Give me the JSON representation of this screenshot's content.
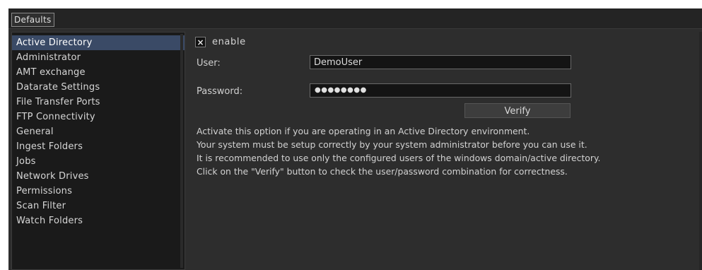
{
  "tabs": [
    {
      "label": "Defaults",
      "active": true
    }
  ],
  "sidebar": {
    "selected_index": 0,
    "items": [
      {
        "label": "Active Directory"
      },
      {
        "label": "Administrator"
      },
      {
        "label": "AMT exchange"
      },
      {
        "label": "Datarate Settings"
      },
      {
        "label": "File Transfer Ports"
      },
      {
        "label": "FTP Connectivity"
      },
      {
        "label": "General"
      },
      {
        "label": "Ingest Folders"
      },
      {
        "label": "Jobs"
      },
      {
        "label": "Network Drives"
      },
      {
        "label": "Permissions"
      },
      {
        "label": "Scan Filter"
      },
      {
        "label": "Watch Folders"
      }
    ]
  },
  "form": {
    "enable": {
      "checked": true,
      "mark": "×",
      "label": "enable"
    },
    "user": {
      "label": "User:",
      "value": "DemoUser"
    },
    "password": {
      "label": "Password:",
      "masked": "●●●●●●●●"
    },
    "verify_label": "Verify"
  },
  "description": [
    "Activate this option if you are operating in an Active Directory environment.",
    "Your system must be setup correctly by your system administrator before you can use it.",
    "It is recommended to use only the configured users of the windows domain/active directory.",
    "Click on the \"Verify\" button to check the user/password combination for correctness."
  ],
  "colors": {
    "panel_bg": "#2d2d2d",
    "sidebar_bg": "#1a1a1a",
    "selection": "#3a4a66",
    "text": "#d4d4d4"
  }
}
